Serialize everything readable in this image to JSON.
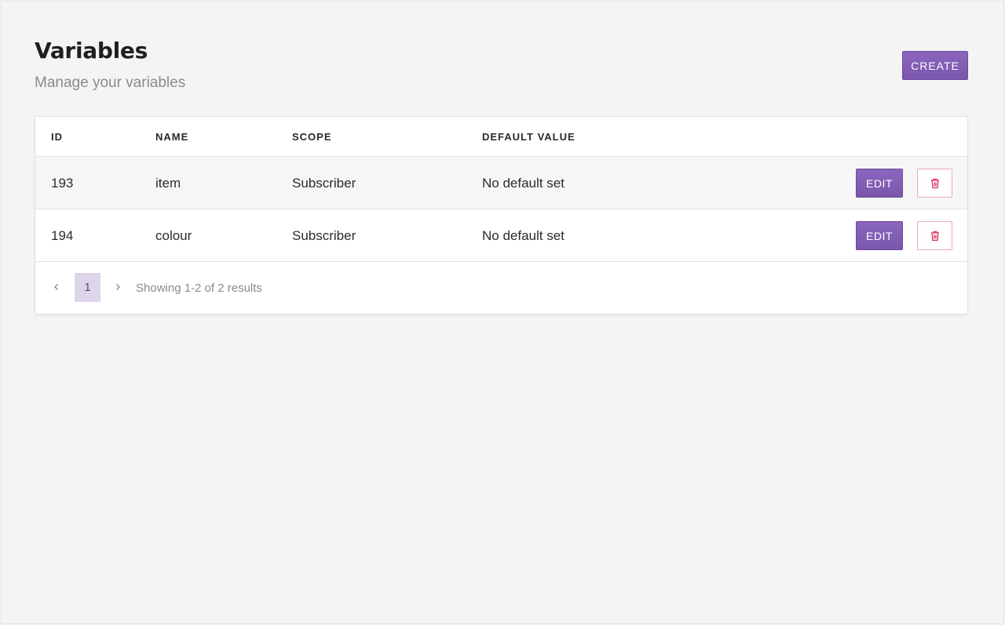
{
  "header": {
    "title": "Variables",
    "subtitle": "Manage your variables",
    "create_label": "CREATE"
  },
  "table": {
    "columns": [
      "ID",
      "NAME",
      "SCOPE",
      "DEFAULT VALUE"
    ],
    "rows": [
      {
        "id": "193",
        "name": "item",
        "scope": "Subscriber",
        "default_value": "No default set",
        "edit_label": "EDIT"
      },
      {
        "id": "194",
        "name": "colour",
        "scope": "Subscriber",
        "default_value": "No default set",
        "edit_label": "EDIT"
      }
    ]
  },
  "pagination": {
    "current_page": "1",
    "info": "Showing 1-2 of 2 results"
  },
  "colors": {
    "accent": "#7e5bb3",
    "danger": "#d9305e",
    "page_active_bg": "#ddd5ea"
  },
  "icons": {
    "prev": "chevron-left-icon",
    "next": "chevron-right-icon",
    "delete": "trash-icon"
  }
}
